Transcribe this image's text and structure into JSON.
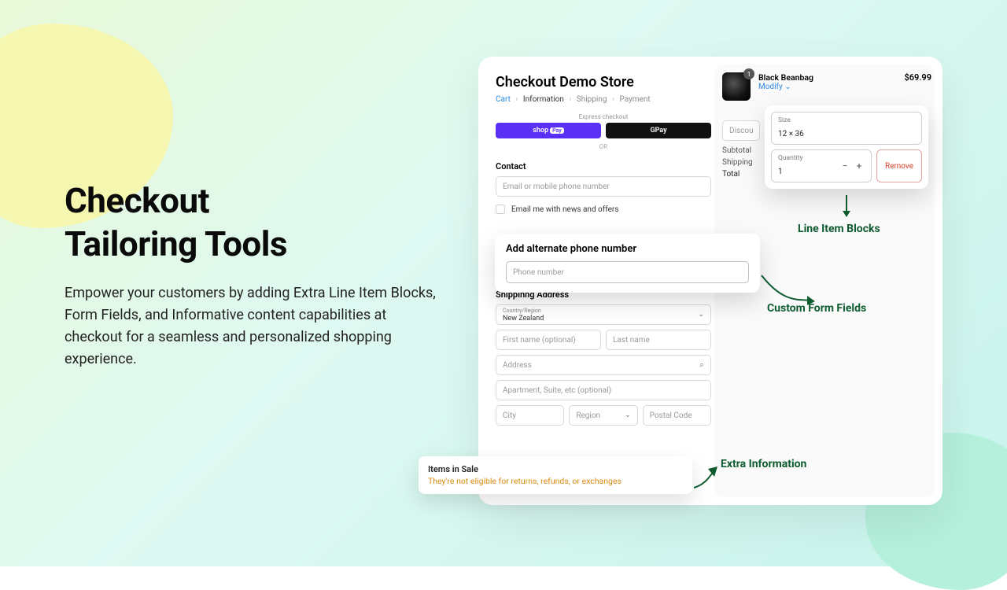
{
  "hero": {
    "title_l1": "Checkout",
    "title_l2": "Tailoring Tools",
    "body": "Empower your customers by adding Extra Line Item Blocks, Form Fields, and Informative content capabilities at checkout for a seamless and personalized shopping experience."
  },
  "store": {
    "title": "Checkout Demo Store"
  },
  "breadcrumbs": {
    "cart": "Cart",
    "information": "Information",
    "shipping": "Shipping",
    "payment": "Payment"
  },
  "express": {
    "label": "Express checkout",
    "shoppay": "shop",
    "shoppay_tag": "Pay",
    "gpay_g": "G",
    "gpay_pay": " Pay",
    "or": "OR"
  },
  "contact": {
    "label": "Contact",
    "email_placeholder": "Email or mobile phone number",
    "news_optin": "Email me with news and offers"
  },
  "alt_phone": {
    "title": "Add alternate phone number",
    "placeholder": "Phone number"
  },
  "shipping": {
    "label": "Shippinng Address",
    "country_label": "Country/Region",
    "country_value": "New Zealand",
    "first_name": "First name (optional)",
    "last_name": "Last name",
    "address": "Address",
    "apt": "Apartment, Suite, etc (optional)",
    "city": "City",
    "region": "Region",
    "postal": "Postal Code"
  },
  "sale_note": {
    "title": "Items in Sale",
    "body": "They're not eligible for returns, refunds, or exchanges"
  },
  "cart": {
    "item_name": "Black Beanbag",
    "modify": "Modify",
    "price": "$69.99",
    "badge": "1",
    "discount_placeholder": "Discount",
    "subtotal_label": "Subtotal",
    "shipping_label": "Shipping",
    "total_label": "Total",
    "size_label": "Size",
    "size_value": "12 × 36",
    "qty_label": "Quantity",
    "qty_value": "1",
    "remove": "Remove"
  },
  "annotations": {
    "line_items": "Line Item Blocks",
    "custom_fields": "Custom Form Fields",
    "extra_info": "Extra Information"
  }
}
